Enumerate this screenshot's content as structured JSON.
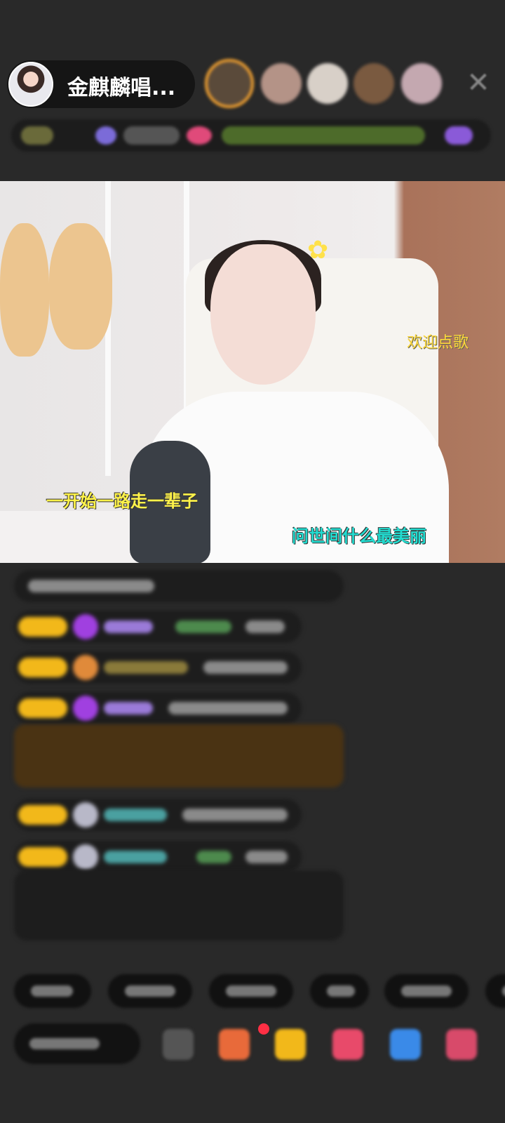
{
  "header": {
    "host_name": "金麒麟唱...",
    "viewers": [
      {
        "icon": "viewer-avatar",
        "color": "#5a4a3a"
      },
      {
        "icon": "viewer-avatar",
        "color": "#b49387"
      },
      {
        "icon": "viewer-avatar",
        "color": "#d8d0c8"
      },
      {
        "icon": "viewer-avatar",
        "color": "#7a5a40"
      },
      {
        "icon": "viewer-avatar",
        "color": "#c4a8b0"
      }
    ],
    "close_icon": "close-icon",
    "close_symbol": "✕"
  },
  "video": {
    "welcome_text": "欢迎点歌",
    "lyric_line_1": "一开始一路走一辈子",
    "lyric_line_2": "问世间什么最美丽",
    "flower_symbol": "✿"
  },
  "colors": {
    "background": "#292929",
    "badge": "#f2b81a",
    "gift_row": "#4a3313",
    "lyric_yellow": "#fff34a",
    "lyric_cyan": "#22dcd0",
    "notification_dot": "#ff2f44"
  }
}
